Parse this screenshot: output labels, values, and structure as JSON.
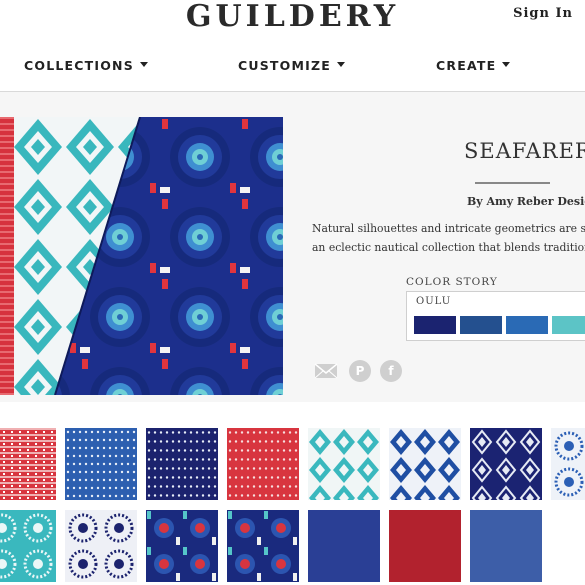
{
  "header": {
    "logo": "GUILDERY",
    "sign_in": "Sign In"
  },
  "nav": {
    "items": [
      {
        "label": "COLLECTIONS"
      },
      {
        "label": "CUSTOMIZE"
      },
      {
        "label": "CREATE"
      }
    ]
  },
  "collection": {
    "title": "SEAFARER",
    "designer": "By Amy Reber Designs",
    "description_line1": "Natural silhouettes and intricate geometrics are spla",
    "description_line2": "an eclectic nautical collection that blends traditional",
    "color_story_label": "COLOR STORY",
    "color_story_name": "OULU",
    "swatches": [
      "#1b2370",
      "#24508f",
      "#2a6ab5",
      "#5cc4c6"
    ]
  },
  "share": {
    "icons": [
      "email-icon",
      "pinterest-icon",
      "facebook-icon"
    ],
    "pinterest_glyph": "P",
    "facebook_glyph": "f"
  },
  "products": {
    "count": 15,
    "tile_names": [
      "red-tribal-stripe",
      "blue-dot-stripe",
      "navy-dot-stripe",
      "red-dot-stripe",
      "aqua-ikat-diamond",
      "blue-ikat-diamond",
      "navy-ikat-diamond",
      "blue-medallion",
      "aqua-medallion",
      "navy-medallion-white",
      "navy-floral-red",
      "navy-floral-red-2",
      "solid-navy",
      "solid-red",
      "solid-blue"
    ]
  }
}
